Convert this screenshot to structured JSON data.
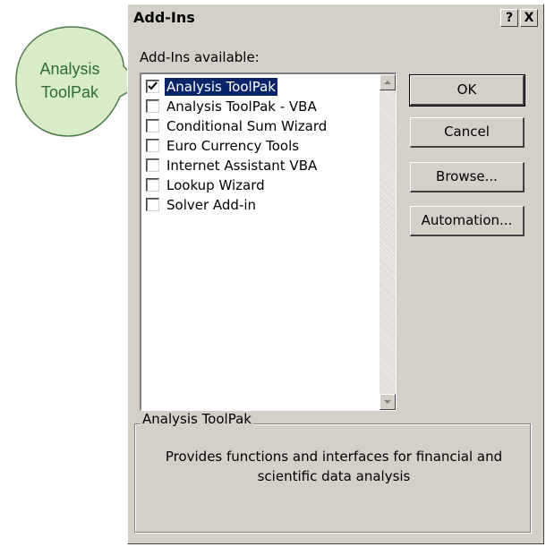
{
  "callout": {
    "text": "Analysis ToolPak",
    "color": "#d9ecc9"
  },
  "dialog": {
    "title": "Add-Ins",
    "help_button": "?",
    "close_button": "X",
    "list_label": "Add-Ins available:",
    "items": [
      {
        "label": "Analysis ToolPak",
        "checked": true,
        "selected": true
      },
      {
        "label": "Analysis ToolPak - VBA",
        "checked": false,
        "selected": false
      },
      {
        "label": "Conditional Sum Wizard",
        "checked": false,
        "selected": false
      },
      {
        "label": "Euro Currency Tools",
        "checked": false,
        "selected": false
      },
      {
        "label": "Internet Assistant VBA",
        "checked": false,
        "selected": false
      },
      {
        "label": "Lookup Wizard",
        "checked": false,
        "selected": false
      },
      {
        "label": "Solver Add-in",
        "checked": false,
        "selected": false
      }
    ],
    "buttons": {
      "ok": "OK",
      "cancel": "Cancel",
      "browse": "Browse...",
      "automation": "Automation..."
    },
    "group": {
      "title": "Analysis ToolPak",
      "description": "Provides functions and interfaces for financial and scientific data analysis"
    }
  }
}
